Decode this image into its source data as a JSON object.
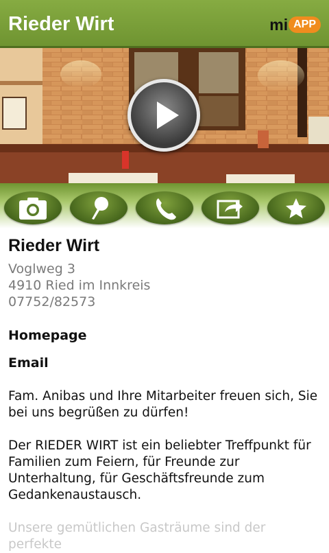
{
  "appbar": {
    "title": "Rieder Wirt",
    "brand_mi": "mi",
    "brand_app": "APP"
  },
  "hero": {
    "image": "restaurant-interior-photo",
    "play_icon": "play-icon"
  },
  "actions": [
    {
      "icon": "camera-icon"
    },
    {
      "icon": "map-pin-icon"
    },
    {
      "icon": "phone-icon"
    },
    {
      "icon": "share-icon"
    },
    {
      "icon": "star-icon"
    }
  ],
  "business": {
    "name": "Rieder Wirt",
    "street": "Voglweg 3",
    "city": "4910 Ried im Innkreis",
    "phone": "07752/82573",
    "homepage_label": "Homepage",
    "email_label": "Email"
  },
  "description": {
    "p1": "Fam. Anibas und Ihre Mitarbeiter freuen sich, Sie bei uns begrüßen zu dürfen!",
    "p2": "Der RIEDER WIRT ist ein beliebter Treffpunkt für Familien zum Feiern, für Freunde zur Unterhaltung, für Geschäftsfreunde zum Gedankenaustausch.",
    "p3": "Unsere gemütlichen Gasträume sind der perfekte"
  },
  "colors": {
    "appbar": "#7a9f38",
    "button": "#5a7d28",
    "brand_accent": "#f08c1e",
    "address_text": "#7a7a7a"
  }
}
